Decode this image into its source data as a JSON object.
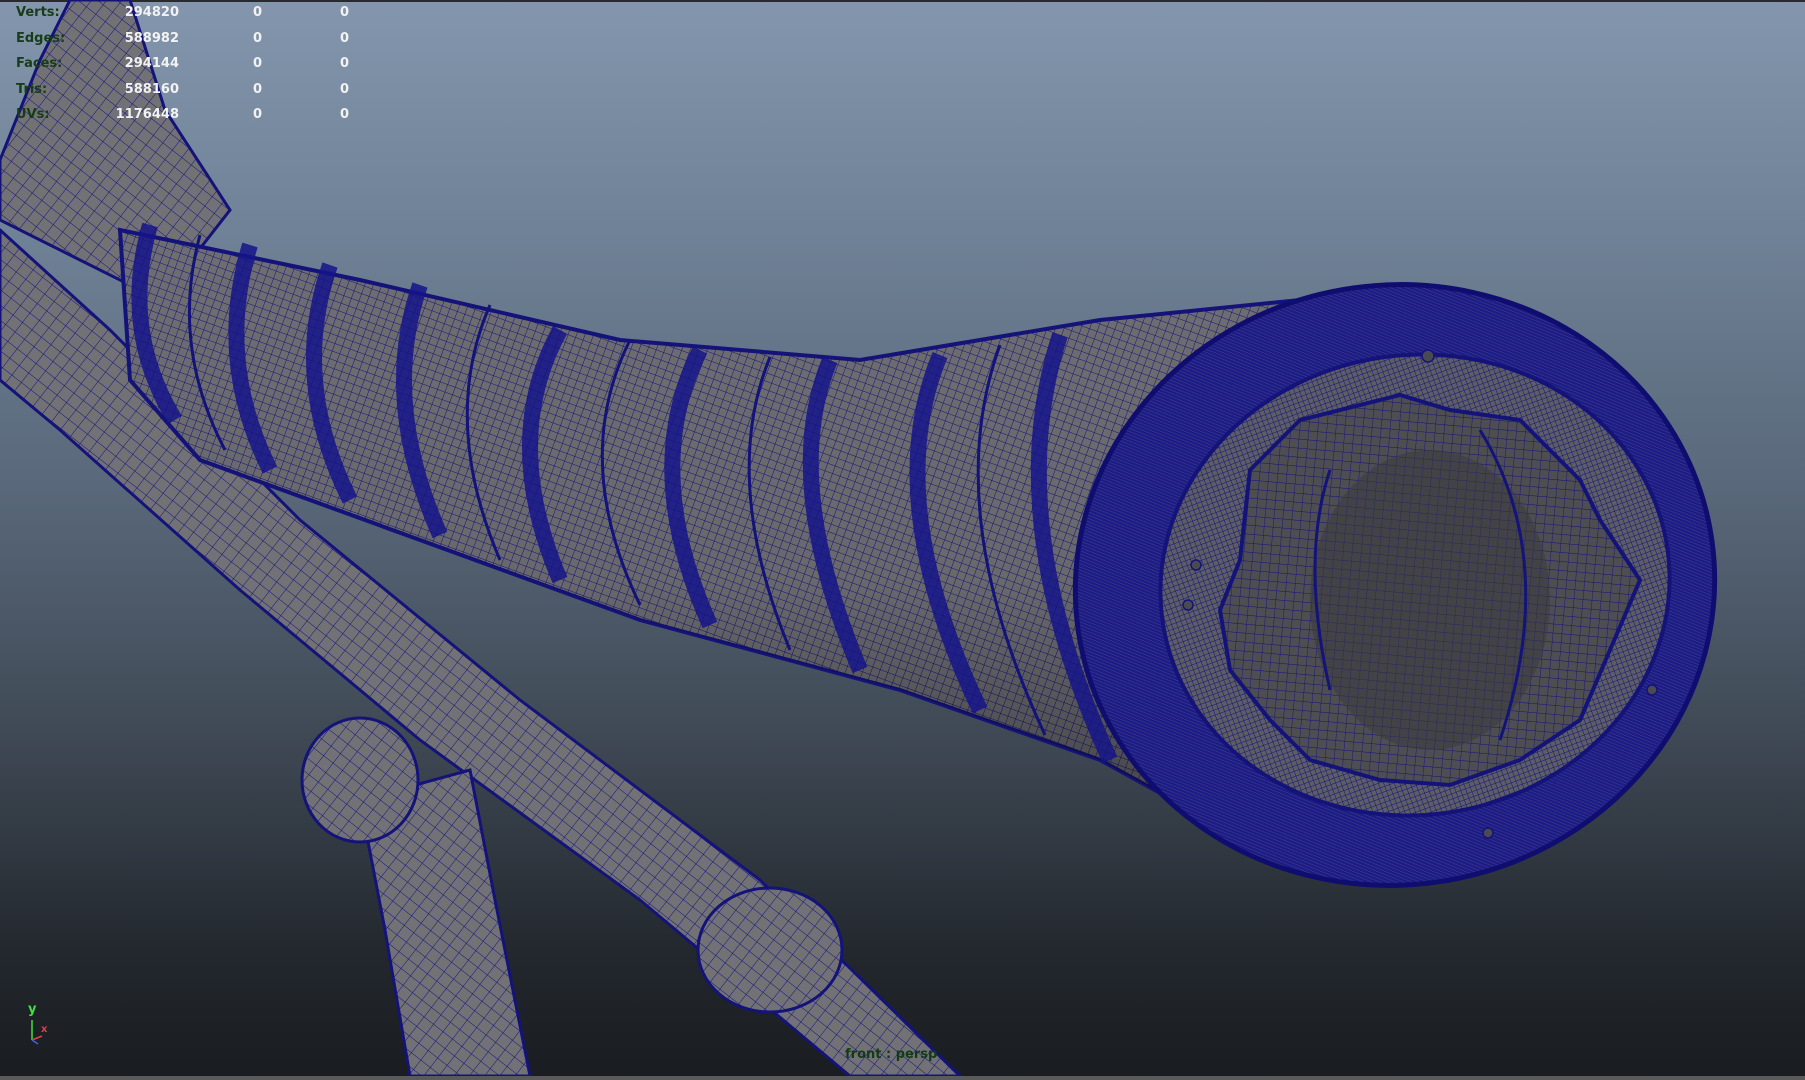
{
  "hud": {
    "rows": [
      {
        "label": "Verts:",
        "values": [
          "294820",
          "0",
          "0"
        ]
      },
      {
        "label": "Edges:",
        "values": [
          "588982",
          "0",
          "0"
        ]
      },
      {
        "label": "Faces:",
        "values": [
          "294144",
          "0",
          "0"
        ]
      },
      {
        "label": "Tris:",
        "values": [
          "588160",
          "0",
          "0"
        ]
      },
      {
        "label": "UVs:",
        "values": [
          "1176448",
          "0",
          "0"
        ]
      }
    ]
  },
  "axis": {
    "y": "y",
    "x": "x"
  },
  "camera_label": "front : persp",
  "colors": {
    "wire": "#14137a",
    "mesh_fill": "#6e6e72",
    "hud_label": "#173d18",
    "hud_value": "#f2f2f2"
  }
}
